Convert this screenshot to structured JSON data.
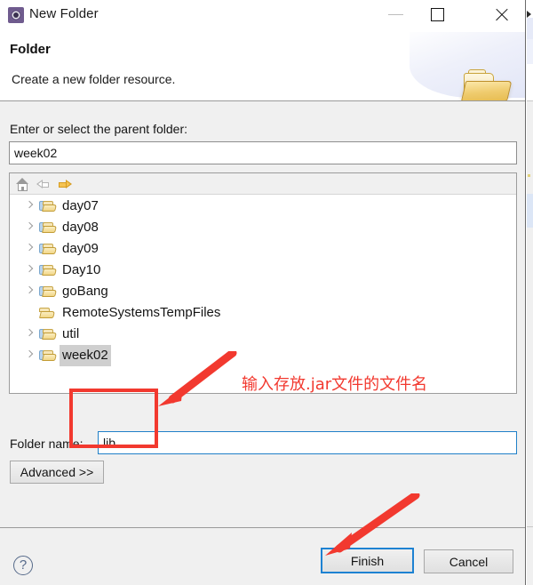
{
  "window": {
    "title": "New Folder",
    "icon": "eclipse-wizard-icon",
    "controls": {
      "minimize": "minimize-icon",
      "maximize": "maximize-icon",
      "close": "close-icon"
    }
  },
  "header": {
    "title": "Folder",
    "subtitle": "Create a new folder resource.",
    "banner_icon": "open-folder-icon"
  },
  "body": {
    "parent_label": "Enter or select the parent folder:",
    "parent_value": "week02",
    "parent_placeholder": "",
    "toolbar": [
      {
        "name": "home-icon",
        "label": "Home",
        "state": "enabled"
      },
      {
        "name": "back-arrow-icon",
        "label": "Back",
        "state": "disabled"
      },
      {
        "name": "forward-arrow-icon",
        "label": "Forward",
        "state": "enabled"
      }
    ],
    "tree": [
      {
        "label": "day07",
        "expandable": true,
        "selected": false,
        "icon": "folder-icon"
      },
      {
        "label": "day08",
        "expandable": true,
        "selected": false,
        "icon": "folder-icon"
      },
      {
        "label": "day09",
        "expandable": true,
        "selected": false,
        "icon": "folder-icon"
      },
      {
        "label": "Day10",
        "expandable": true,
        "selected": false,
        "icon": "folder-icon"
      },
      {
        "label": "goBang",
        "expandable": true,
        "selected": false,
        "icon": "folder-icon"
      },
      {
        "label": "RemoteSystemsTempFiles",
        "expandable": false,
        "selected": false,
        "icon": "folder-plain-icon"
      },
      {
        "label": "util",
        "expandable": true,
        "selected": false,
        "icon": "folder-icon"
      },
      {
        "label": "week02",
        "expandable": true,
        "selected": true,
        "icon": "folder-icon"
      }
    ],
    "folder_name_label": "Folder name:",
    "folder_name_value": "lib",
    "folder_name_placeholder": "",
    "advanced_label": "Advanced >>"
  },
  "footer": {
    "help_icon": "help-question-icon",
    "help_glyph": "?",
    "finish_label": "Finish",
    "cancel_label": "Cancel"
  },
  "annotations": {
    "note_text": "输入存放.jar文件的文件名",
    "color": "#f2392f",
    "highlight_rect_target": "folder-name-input",
    "arrow_1_target": "folder-name-input",
    "arrow_2_target": "finish-button"
  }
}
